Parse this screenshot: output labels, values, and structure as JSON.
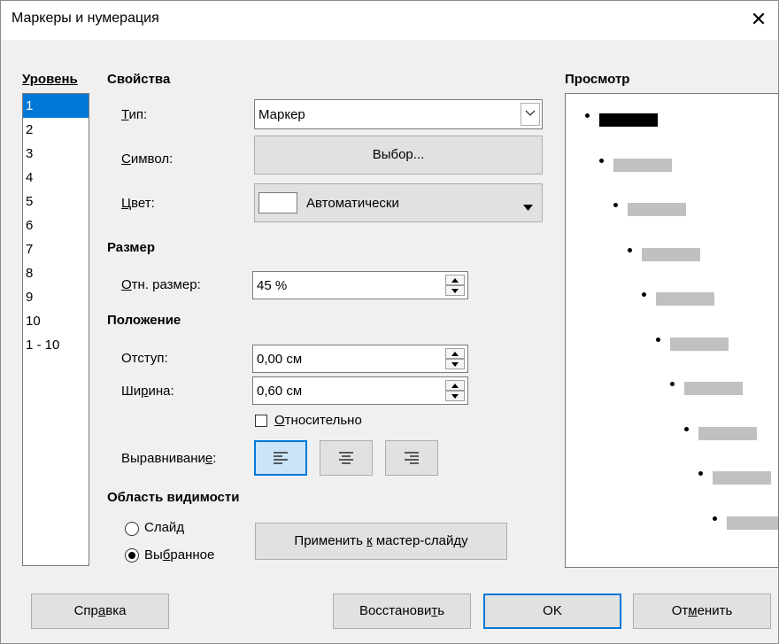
{
  "window": {
    "title": "Маркеры и нумерация"
  },
  "level": {
    "heading": "Уровень",
    "items": [
      "1",
      "2",
      "3",
      "4",
      "5",
      "6",
      "7",
      "8",
      "9",
      "10",
      "1 - 10"
    ],
    "selected": "1"
  },
  "properties": {
    "heading": "Свойства",
    "type_label": "Тип:",
    "type_value": "Маркер",
    "symbol_label": "Символ:",
    "symbol_button": "Выбор...",
    "color_label": "Цвет:",
    "color_value": "Автоматически"
  },
  "size": {
    "heading": "Размер",
    "rel_label": "Отн. размер:",
    "rel_value": "45 %"
  },
  "position": {
    "heading": "Положение",
    "indent_label": "Отступ:",
    "indent_value": "0,00 см",
    "width_label": "Ширина:",
    "width_value": "0,60 см",
    "relative_label": "Относительно",
    "relative_checked": false,
    "align_label": "Выравнивание:",
    "align_selected": "left"
  },
  "scope": {
    "heading": "Область видимости",
    "slide_label": "Слайд",
    "selection_label": "Выбранное",
    "selected": "selection",
    "apply_button": "Применить к мастер-слайду"
  },
  "preview": {
    "heading": "Просмотр"
  },
  "footer": {
    "help": "Справка",
    "reset": "Восстановить",
    "ok": "OK",
    "cancel": "Отменить"
  },
  "colors": {
    "accent": "#0078d7",
    "preview_bar": "#c0c0c0"
  }
}
